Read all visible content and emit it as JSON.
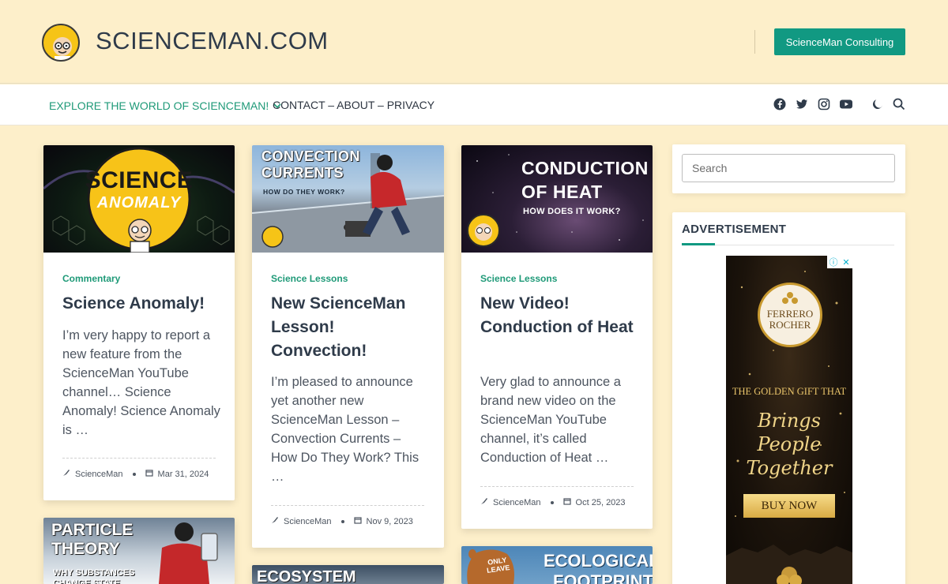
{
  "header": {
    "site_title": "SCIENCEMAN.COM",
    "consult_button": "ScienceMan Consulting"
  },
  "nav": {
    "explore": "EXPLORE THE WORLD OF SCIENCEMAN!",
    "contact": "CONTACT – ABOUT – PRIVACY",
    "icons": [
      "facebook-icon",
      "twitter-icon",
      "instagram-icon",
      "youtube-icon",
      "moon-icon",
      "search-icon"
    ]
  },
  "posts": [
    {
      "image_title_line1": "SCIENCE",
      "image_title_line2": "ANOMALY",
      "category": "Commentary",
      "title": "Science Anomaly!",
      "excerpt": "I’m very happy to report a new feature from the ScienceMan YouTube channel… Science Anomaly! Science Anomaly is …",
      "author": "ScienceMan",
      "date": "Mar 31, 2024"
    },
    {
      "image_title_line1": "CONVECTION",
      "image_title_line2": "CURRENTS",
      "image_subtitle": "HOW DO THEY WORK?",
      "category": "Science Lessons",
      "title": "New ScienceMan Lesson! Convection!",
      "excerpt": "I’m pleased to announce yet another new ScienceMan Lesson – Convection Currents – How Do They Work? This …",
      "author": "ScienceMan",
      "date": "Nov 9, 2023"
    },
    {
      "image_title_line1": "CONDUCTION",
      "image_title_line2": "OF HEAT",
      "image_subtitle": "HOW DOES IT WORK?",
      "category": "Science Lessons",
      "title": "New Video! Conduction of Heat",
      "excerpt": "Very glad to announce a brand new video on the ScienceMan YouTube channel, it’s called Conduction of Heat …",
      "author": "ScienceMan",
      "date": "Oct 25, 2023"
    }
  ],
  "next_posts": [
    {
      "image_title_line1": "PARTICLE",
      "image_title_line2": "THEORY",
      "image_subtitle": "WHY SUBSTANCES CHANGE STATE"
    },
    {
      "image_title_line1": "ECOSYSTEM"
    },
    {
      "image_title_line1": "ECOLOGICAL",
      "image_title_line2": "FOOTPRINT",
      "image_badge": "ONLY LEAVE"
    }
  ],
  "sidebar": {
    "search_placeholder": "Search",
    "ad_heading": "ADVERTISEMENT",
    "ad": {
      "brand": "FERRERO ROCHER",
      "tagline1": "THE GOLDEN GIFT THAT",
      "tagline2": "Brings People Together",
      "button": "BUY NOW"
    }
  },
  "colors": {
    "background": "#fdefca",
    "accent": "#119982",
    "nav_link": "#1f9a78",
    "text": "#2f3b4a"
  }
}
